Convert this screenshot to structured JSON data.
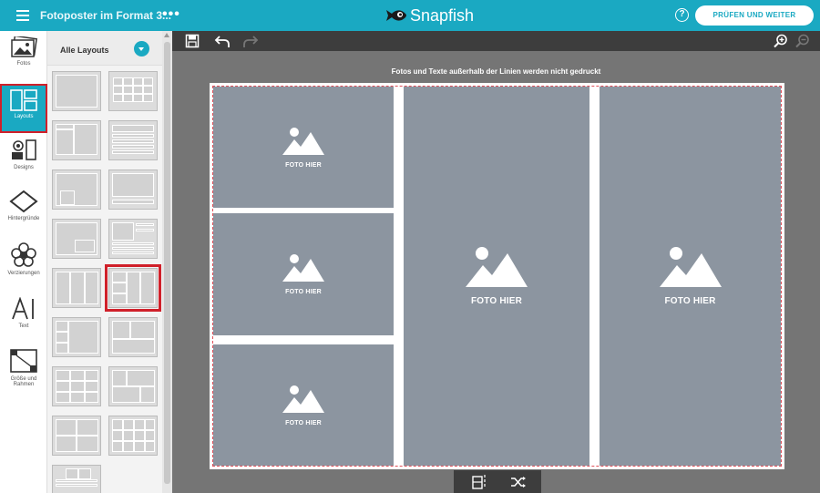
{
  "header": {
    "doc_title": "Fotoposter im Format 3...",
    "more": "•••",
    "brand": "Snapfish",
    "help": "?",
    "cta_label": "PRÜFEN UND WEITER"
  },
  "rail": {
    "items": [
      {
        "label": "Fotos",
        "icon": "photos-icon"
      },
      {
        "label": "Layouts",
        "icon": "layouts-icon"
      },
      {
        "label": "Designs",
        "icon": "designs-icon"
      },
      {
        "label": "Hintergründe",
        "icon": "backgrounds-icon"
      },
      {
        "label": "Verzierungen",
        "icon": "embellishments-icon"
      },
      {
        "label": "Text",
        "icon": "text-icon"
      },
      {
        "label": "Größe und Rahmen",
        "icon": "size-frame-icon"
      }
    ],
    "active": "Layouts"
  },
  "layouts_panel": {
    "title": "Alle Layouts",
    "selected_index": 9
  },
  "editor": {
    "notice": "Fotos und Texte außerhalb der Linien werden nicht gedruckt",
    "slots": [
      {
        "label": "FOTO HIER"
      },
      {
        "label": "FOTO HIER"
      },
      {
        "label": "FOTO HIER"
      },
      {
        "label": "FOTO HIER"
      },
      {
        "label": "FOTO HIER"
      }
    ]
  },
  "colors": {
    "brand": "#1aa9c2",
    "selection": "#d0202a",
    "slot": "#8c95a0",
    "toolbar": "#3d3d3d",
    "workspace": "#757575"
  }
}
